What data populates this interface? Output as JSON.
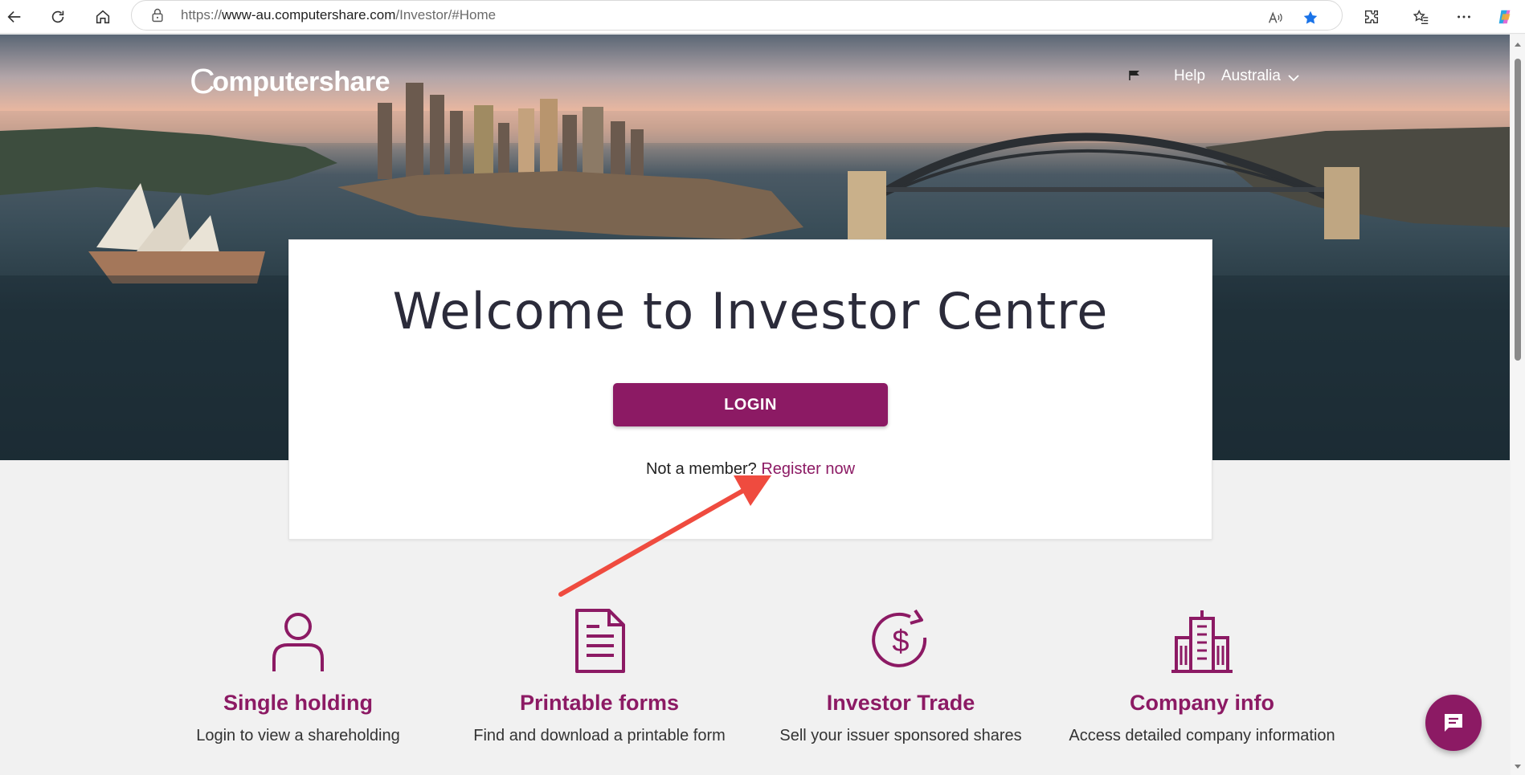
{
  "browser": {
    "url_prefix": "https://",
    "url_domain": "www-au.computershare.com",
    "url_path": "/Investor/#Home"
  },
  "site": {
    "brand": "omputershare",
    "brand_c": "C",
    "nav": {
      "help": "Help",
      "country": "Australia"
    }
  },
  "welcome": {
    "title": "Welcome to Investor Centre",
    "login_label": "LOGIN",
    "not_member": "Not a member?",
    "register_label": "Register now"
  },
  "features": [
    {
      "icon": "person-icon",
      "title": "Single holding",
      "description": "Login to view a shareholding"
    },
    {
      "icon": "document-icon",
      "title": "Printable forms",
      "description": "Find and download a printable form"
    },
    {
      "icon": "dollar-cycle-icon",
      "title": "Investor Trade",
      "description": "Sell your issuer sponsored shares"
    },
    {
      "icon": "building-icon",
      "title": "Company info",
      "description": "Access detailed company information"
    }
  ],
  "colors": {
    "brand": "#8c1a64",
    "annotation_arrow": "#ef4b3f"
  }
}
